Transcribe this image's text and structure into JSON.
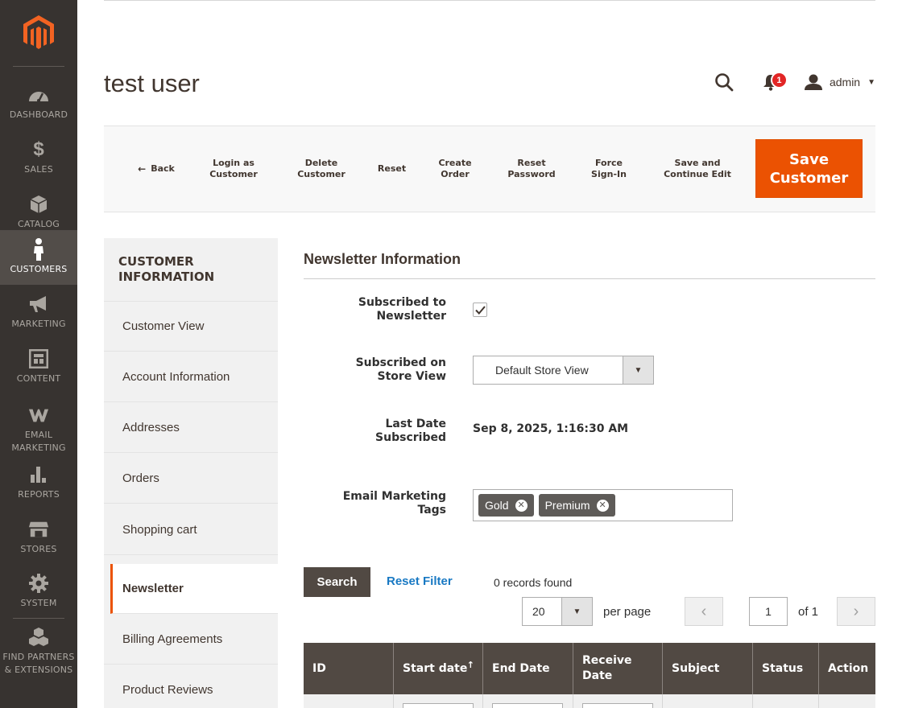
{
  "menu": {
    "items": [
      {
        "label": "DASHBOARD",
        "icon": "dashboard-icon"
      },
      {
        "label": "SALES",
        "icon": "dollar-icon"
      },
      {
        "label": "CATALOG",
        "icon": "box-icon"
      },
      {
        "label": "CUSTOMERS",
        "icon": "person-icon",
        "active": true
      },
      {
        "label": "MARKETING",
        "icon": "megaphone-icon"
      },
      {
        "label": "CONTENT",
        "icon": "layout-icon"
      },
      {
        "label": "EMAIL\nMARKETING",
        "icon": "email-marketing-icon"
      },
      {
        "label": "REPORTS",
        "icon": "bar-chart-icon"
      },
      {
        "label": "STORES",
        "icon": "store-icon"
      },
      {
        "label": "SYSTEM",
        "icon": "gear-icon"
      },
      {
        "label": "FIND PARTNERS\n& EXTENSIONS",
        "icon": "cubes-icon"
      }
    ]
  },
  "header": {
    "title": "test user",
    "notifications_count": "1",
    "user_name": "admin"
  },
  "toolbar": {
    "back": "Back",
    "login_as_customer": "Login as\nCustomer",
    "delete_customer": "Delete\nCustomer",
    "reset": "Reset",
    "create_order": "Create\nOrder",
    "reset_password": "Reset\nPassword",
    "force_sign_in": "Force\nSign-In",
    "save_continue": "Save and\nContinue Edit",
    "save_customer": "Save\nCustomer"
  },
  "side": {
    "title": "CUSTOMER\nINFORMATION",
    "tabs": [
      {
        "label": "Customer View"
      },
      {
        "label": "Account Information"
      },
      {
        "label": "Addresses"
      },
      {
        "label": "Orders"
      },
      {
        "label": "Shopping cart"
      },
      {
        "label": "Newsletter",
        "active": true
      },
      {
        "label": "Billing Agreements"
      },
      {
        "label": "Product Reviews"
      }
    ]
  },
  "newsletter": {
    "section_title": "Newsletter Information",
    "subscribed_label": "Subscribed to\nNewsletter",
    "subscribed_checked": true,
    "store_view_label": "Subscribed on\nStore View",
    "store_view_value": "Default Store View",
    "last_date_label": "Last Date\nSubscribed",
    "last_date_value": "Sep 8, 2025, 1:16:30 AM",
    "tags_label": "Email Marketing\nTags",
    "tags": [
      "Gold",
      "Premium"
    ]
  },
  "grid": {
    "search_label": "Search",
    "reset_filter_label": "Reset Filter",
    "records_found": "0 records found",
    "per_page_value": "20",
    "per_page_label": "per page",
    "page_value": "1",
    "page_of": "of 1",
    "columns": [
      "ID",
      "Start date",
      "End Date",
      "Receive\nDate",
      "Subject",
      "Status",
      "Action"
    ]
  },
  "colors": {
    "accent": "#eb5202",
    "menu_bg": "#373330",
    "grid_header": "#514943",
    "link": "#1979c3"
  }
}
